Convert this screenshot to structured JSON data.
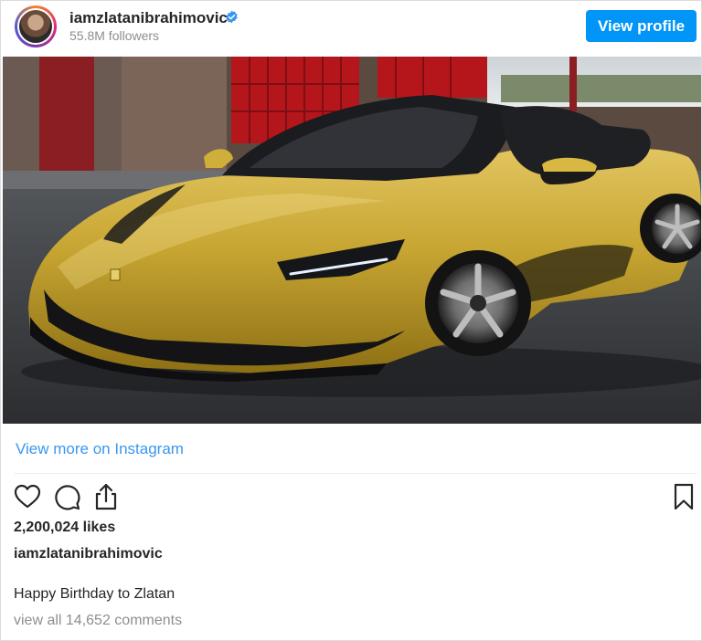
{
  "header": {
    "username": "iamzlatanibrahimovic",
    "followers": "55.8M followers",
    "verified_color": "#3897f0",
    "view_profile_label": "View profile"
  },
  "post": {
    "photo_subject": "yellow-gold Ferrari SF90 Spider convertible",
    "view_more_label": "View more on Instagram",
    "likes": "2,200,024 likes",
    "caption_user": "iamzlatanibrahimovic",
    "caption_text": "Happy Birthday to Zlatan",
    "comments_link": "view all 14,652 comments"
  },
  "icons": [
    "heart-icon",
    "comment-icon",
    "share-icon",
    "bookmark-icon"
  ],
  "colors": {
    "accent": "#0095f6",
    "link": "#3897f0",
    "muted": "#8e8e8e",
    "car_gold": "#c7a532"
  }
}
